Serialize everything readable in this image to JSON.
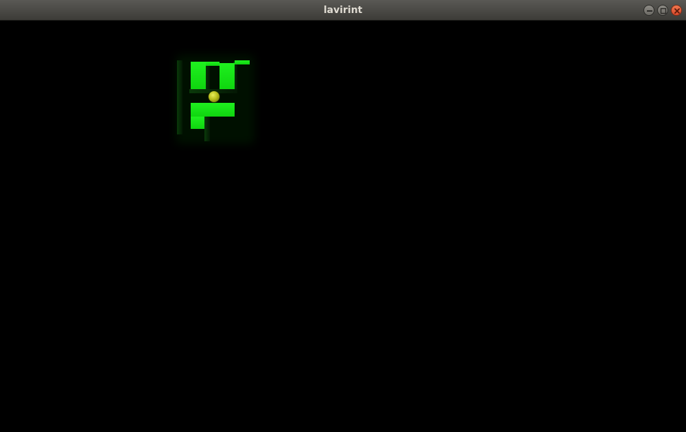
{
  "window": {
    "title": "lavirint"
  },
  "controls": {
    "minimize": "minimize-icon",
    "maximize": "maximize-icon",
    "close": "close-icon"
  },
  "colors": {
    "wall": "#1ff01f",
    "ball": "#c8cf24",
    "background": "#000000"
  }
}
